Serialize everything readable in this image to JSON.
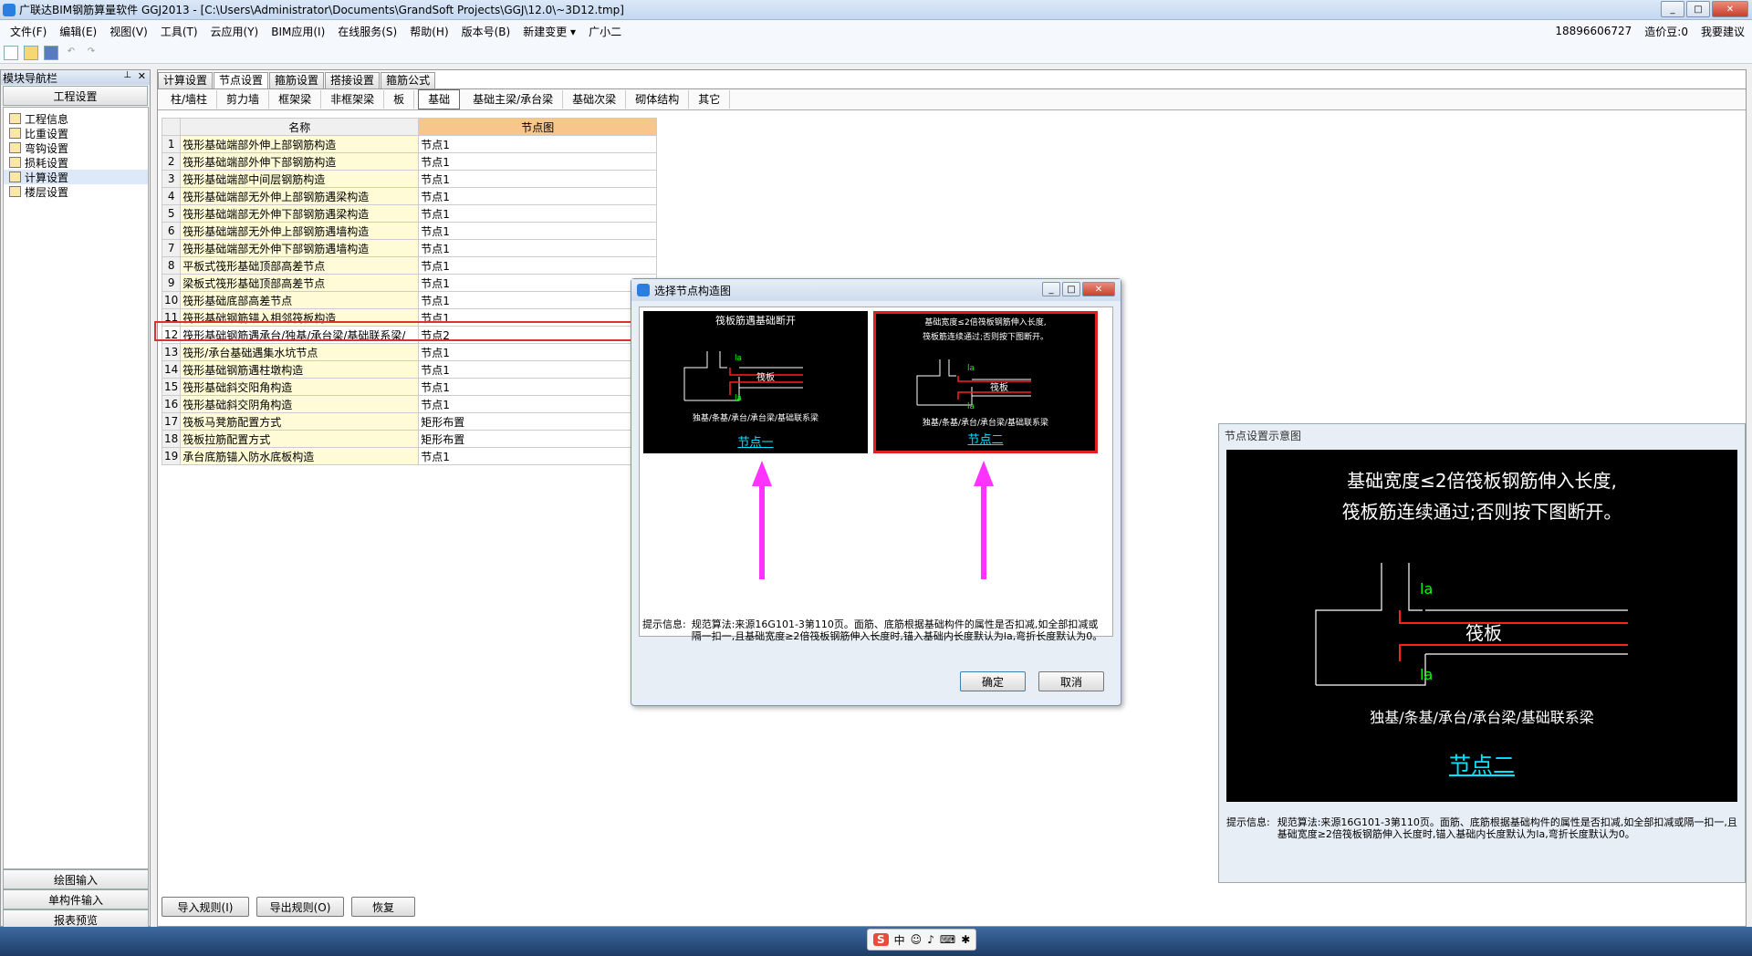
{
  "window": {
    "title": "广联达BIM钢筋算量软件 GGJ2013 - [C:\\Users\\Administrator\\Documents\\GrandSoft Projects\\GGJ\\12.0\\~3D12.tmp]",
    "min": "_",
    "max": "□",
    "close": "✕"
  },
  "menu": {
    "items": [
      "文件(F)",
      "编辑(E)",
      "视图(V)",
      "工具(T)",
      "云应用(Y)",
      "BIM应用(I)",
      "在线服务(S)",
      "帮助(H)",
      "版本号(B)",
      "新建变更 ▾",
      "广小二"
    ],
    "phone": "18896606727",
    "beans": "造价豆:0",
    "suggest": "我要建议"
  },
  "sidebar": {
    "header": "模块导航栏",
    "project_btn": "工程设置",
    "tree": [
      "工程信息",
      "比重设置",
      "弯钩设置",
      "损耗设置",
      "计算设置",
      "楼层设置"
    ],
    "bottom": [
      "绘图输入",
      "单构件输入",
      "报表预览"
    ]
  },
  "tabs_top": [
    "计算设置",
    "节点设置",
    "箍筋设置",
    "搭接设置",
    "箍筋公式"
  ],
  "tabs_sub": [
    "柱/墙柱",
    "剪力墙",
    "框架梁",
    "非框架梁",
    "板",
    "基础",
    "基础主梁/承台梁",
    "基础次梁",
    "砌体结构",
    "其它"
  ],
  "grid": {
    "col_name": "名称",
    "col_node": "节点图",
    "rows": [
      {
        "n": "1",
        "name": "筏形基础端部外伸上部钢筋构造",
        "val": "节点1"
      },
      {
        "n": "2",
        "name": "筏形基础端部外伸下部钢筋构造",
        "val": "节点1"
      },
      {
        "n": "3",
        "name": "筏形基础端部中间层钢筋构造",
        "val": "节点1"
      },
      {
        "n": "4",
        "name": "筏形基础端部无外伸上部钢筋遇梁构造",
        "val": "节点1"
      },
      {
        "n": "5",
        "name": "筏形基础端部无外伸下部钢筋遇梁构造",
        "val": "节点1"
      },
      {
        "n": "6",
        "name": "筏形基础端部无外伸上部钢筋遇墙构造",
        "val": "节点1"
      },
      {
        "n": "7",
        "name": "筏形基础端部无外伸下部钢筋遇墙构造",
        "val": "节点1"
      },
      {
        "n": "8",
        "name": "平板式筏形基础顶部高差节点",
        "val": "节点1"
      },
      {
        "n": "9",
        "name": "梁板式筏形基础顶部高差节点",
        "val": "节点1"
      },
      {
        "n": "10",
        "name": "筏形基础底部高差节点",
        "val": "节点1"
      },
      {
        "n": "11",
        "name": "筏形基础钢筋锚入相邻筏板构造",
        "val": "节点1"
      },
      {
        "n": "12",
        "name": "筏形基础钢筋遇承台/独基/承台梁/基础联系梁/",
        "val": "节点2"
      },
      {
        "n": "13",
        "name": "筏形/承台基础遇集水坑节点",
        "val": "节点1"
      },
      {
        "n": "14",
        "name": "筏形基础钢筋遇柱墩构造",
        "val": "节点1"
      },
      {
        "n": "15",
        "name": "筏形基础斜交阳角构造",
        "val": "节点1"
      },
      {
        "n": "16",
        "name": "筏形基础斜交阴角构造",
        "val": "节点1"
      },
      {
        "n": "17",
        "name": "筏板马凳筋配置方式",
        "val": "矩形布置"
      },
      {
        "n": "18",
        "name": "筏板拉筋配置方式",
        "val": "矩形布置"
      },
      {
        "n": "19",
        "name": "承台底筋锚入防水底板构造",
        "val": "节点1"
      }
    ]
  },
  "bottom_buttons": [
    "导入规则(I)",
    "导出规则(O)",
    "恢复"
  ],
  "dialog": {
    "title": "选择节点构造图",
    "thumb1_title": "筏板筋遇基础断开",
    "thumb1_label": "筏板",
    "thumb1_sub": "独基/条基/承台/承台梁/基础联系梁",
    "thumb1_caption": "节点一",
    "thumb2_title1": "基础宽度≤2倍筏板钢筋伸入长度,",
    "thumb2_title2": "筏板筋连续通过;否则按下图断开。",
    "thumb2_label": "筏板",
    "thumb2_sub": "独基/条基/承台/承台梁/基础联系梁",
    "thumb2_caption": "节点二",
    "hint_label": "提示信息:",
    "hint": "规范算法:来源16G101-3第110页。面筋、底筋根据基础构件的属性是否扣减,如全部扣减或隔一扣一,且基础宽度≥2倍筏板钢筋伸入长度时,锚入基础内长度默认为la,弯折长度默认为0。",
    "ok": "确定",
    "cancel": "取消",
    "la": "la"
  },
  "preview": {
    "title": "节点设置示意图",
    "line1": "基础宽度≤2倍筏板钢筋伸入长度,",
    "line2": "筏板筋连续通过;否则按下图断开。",
    "la": "la",
    "label": "筏板",
    "sub": "独基/条基/承台/承台梁/基础联系梁",
    "caption": "节点二",
    "hint_label": "提示信息:",
    "hint": "规范算法:来源16G101-3第110页。面筋、底筋根据基础构件的属性是否扣减,如全部扣减或隔一扣一,且基础宽度≥2倍筏板钢筋伸入长度时,锚入基础内长度默认为la,弯折长度默认为0。"
  },
  "ime": {
    "logo": "S",
    "label": "中"
  },
  "colors": {
    "highlight_red": "#e03030",
    "arrow_magenta": "#ff33ff",
    "cyan": "#00e5ff"
  }
}
